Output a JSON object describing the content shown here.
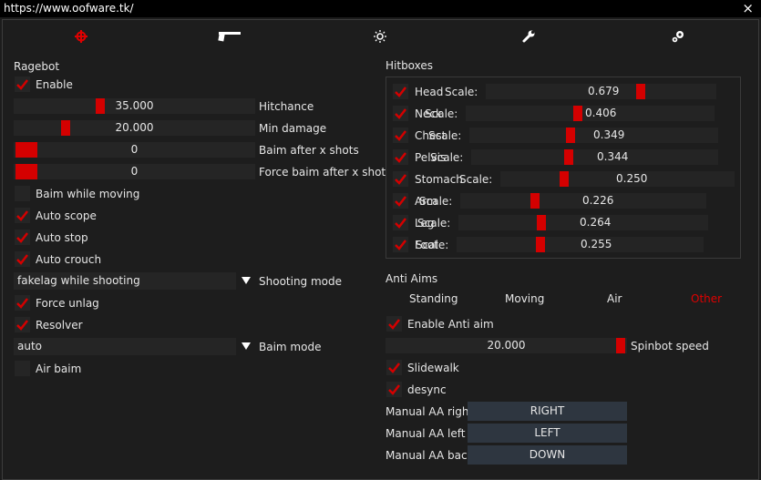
{
  "window": {
    "title": "https://www.oofware.tk/",
    "close_icon": "×"
  },
  "tabs": [
    {
      "name": "ragebot",
      "icon": "crosshair-icon",
      "active": true
    },
    {
      "name": "weapon",
      "icon": "pistol-icon",
      "active": false
    },
    {
      "name": "visuals",
      "icon": "sun-icon",
      "active": false
    },
    {
      "name": "misc",
      "icon": "wrench-icon",
      "active": false
    },
    {
      "name": "settings",
      "icon": "gears-icon",
      "active": false
    }
  ],
  "ragebot": {
    "title": "Ragebot",
    "enable": {
      "label": "Enable",
      "checked": true
    },
    "hitchance": {
      "label": "Hitchance",
      "value": "35.000",
      "fraction": 0.35
    },
    "min_damage": {
      "label": "Min damage",
      "value": "20.000",
      "fraction": 0.2
    },
    "baim_after": {
      "label": "Baim after x shots",
      "value": "0",
      "fraction": 0
    },
    "force_baim_after": {
      "label": "Force baim after x shots",
      "value": "0",
      "fraction": 0
    },
    "baim_while_moving": {
      "label": "Baim while moving",
      "checked": false
    },
    "auto_scope": {
      "label": "Auto scope",
      "checked": true
    },
    "auto_stop": {
      "label": "Auto stop",
      "checked": true
    },
    "auto_crouch": {
      "label": "Auto crouch",
      "checked": true
    },
    "shooting_mode": {
      "label": "Shooting mode",
      "value": "fakelag while shooting"
    },
    "force_unlag": {
      "label": "Force unlag",
      "checked": true
    },
    "resolver": {
      "label": "Resolver",
      "checked": true
    },
    "baim_mode": {
      "label": "Baim mode",
      "value": "auto"
    },
    "air_baim": {
      "label": "Air baim",
      "checked": false
    }
  },
  "hitboxes": {
    "title": "Hitboxes",
    "scale_label": "Scale:",
    "items": [
      {
        "name": "Head",
        "checked": true,
        "scale": "0.679"
      },
      {
        "name": "Neck",
        "checked": true,
        "scale": "0.406"
      },
      {
        "name": "Chest",
        "checked": true,
        "scale": "0.349"
      },
      {
        "name": "Pelvis",
        "checked": true,
        "scale": "0.344"
      },
      {
        "name": "Stomach",
        "checked": true,
        "scale": "0.250"
      },
      {
        "name": "Arm",
        "checked": true,
        "scale": "0.226"
      },
      {
        "name": "Leg",
        "checked": true,
        "scale": "0.264"
      },
      {
        "name": "Foot",
        "checked": true,
        "scale": "0.255"
      }
    ]
  },
  "anti_aims": {
    "title": "Anti Aims",
    "tabs": [
      "Standing",
      "Moving",
      "Air",
      "Other"
    ],
    "active_tab": "Other",
    "enable": {
      "label": "Enable Anti aim",
      "checked": true
    },
    "spinbot_speed": {
      "label": "Spinbot speed",
      "value": "20.000",
      "fraction": 1.0
    },
    "slidewalk": {
      "label": "Slidewalk",
      "checked": true
    },
    "desync": {
      "label": "desync",
      "checked": true
    },
    "manual_right": {
      "label": "Manual AA right",
      "button": "RIGHT"
    },
    "manual_left": {
      "label": "Manual AA left",
      "button": "LEFT"
    },
    "manual_back": {
      "label": "Manual AA back",
      "button": "DOWN"
    }
  },
  "colors": {
    "accent": "#d40000",
    "background": "#1d1d1d",
    "control": "#252525",
    "button": "#2e3640",
    "active_tab_text": "#e00000"
  }
}
